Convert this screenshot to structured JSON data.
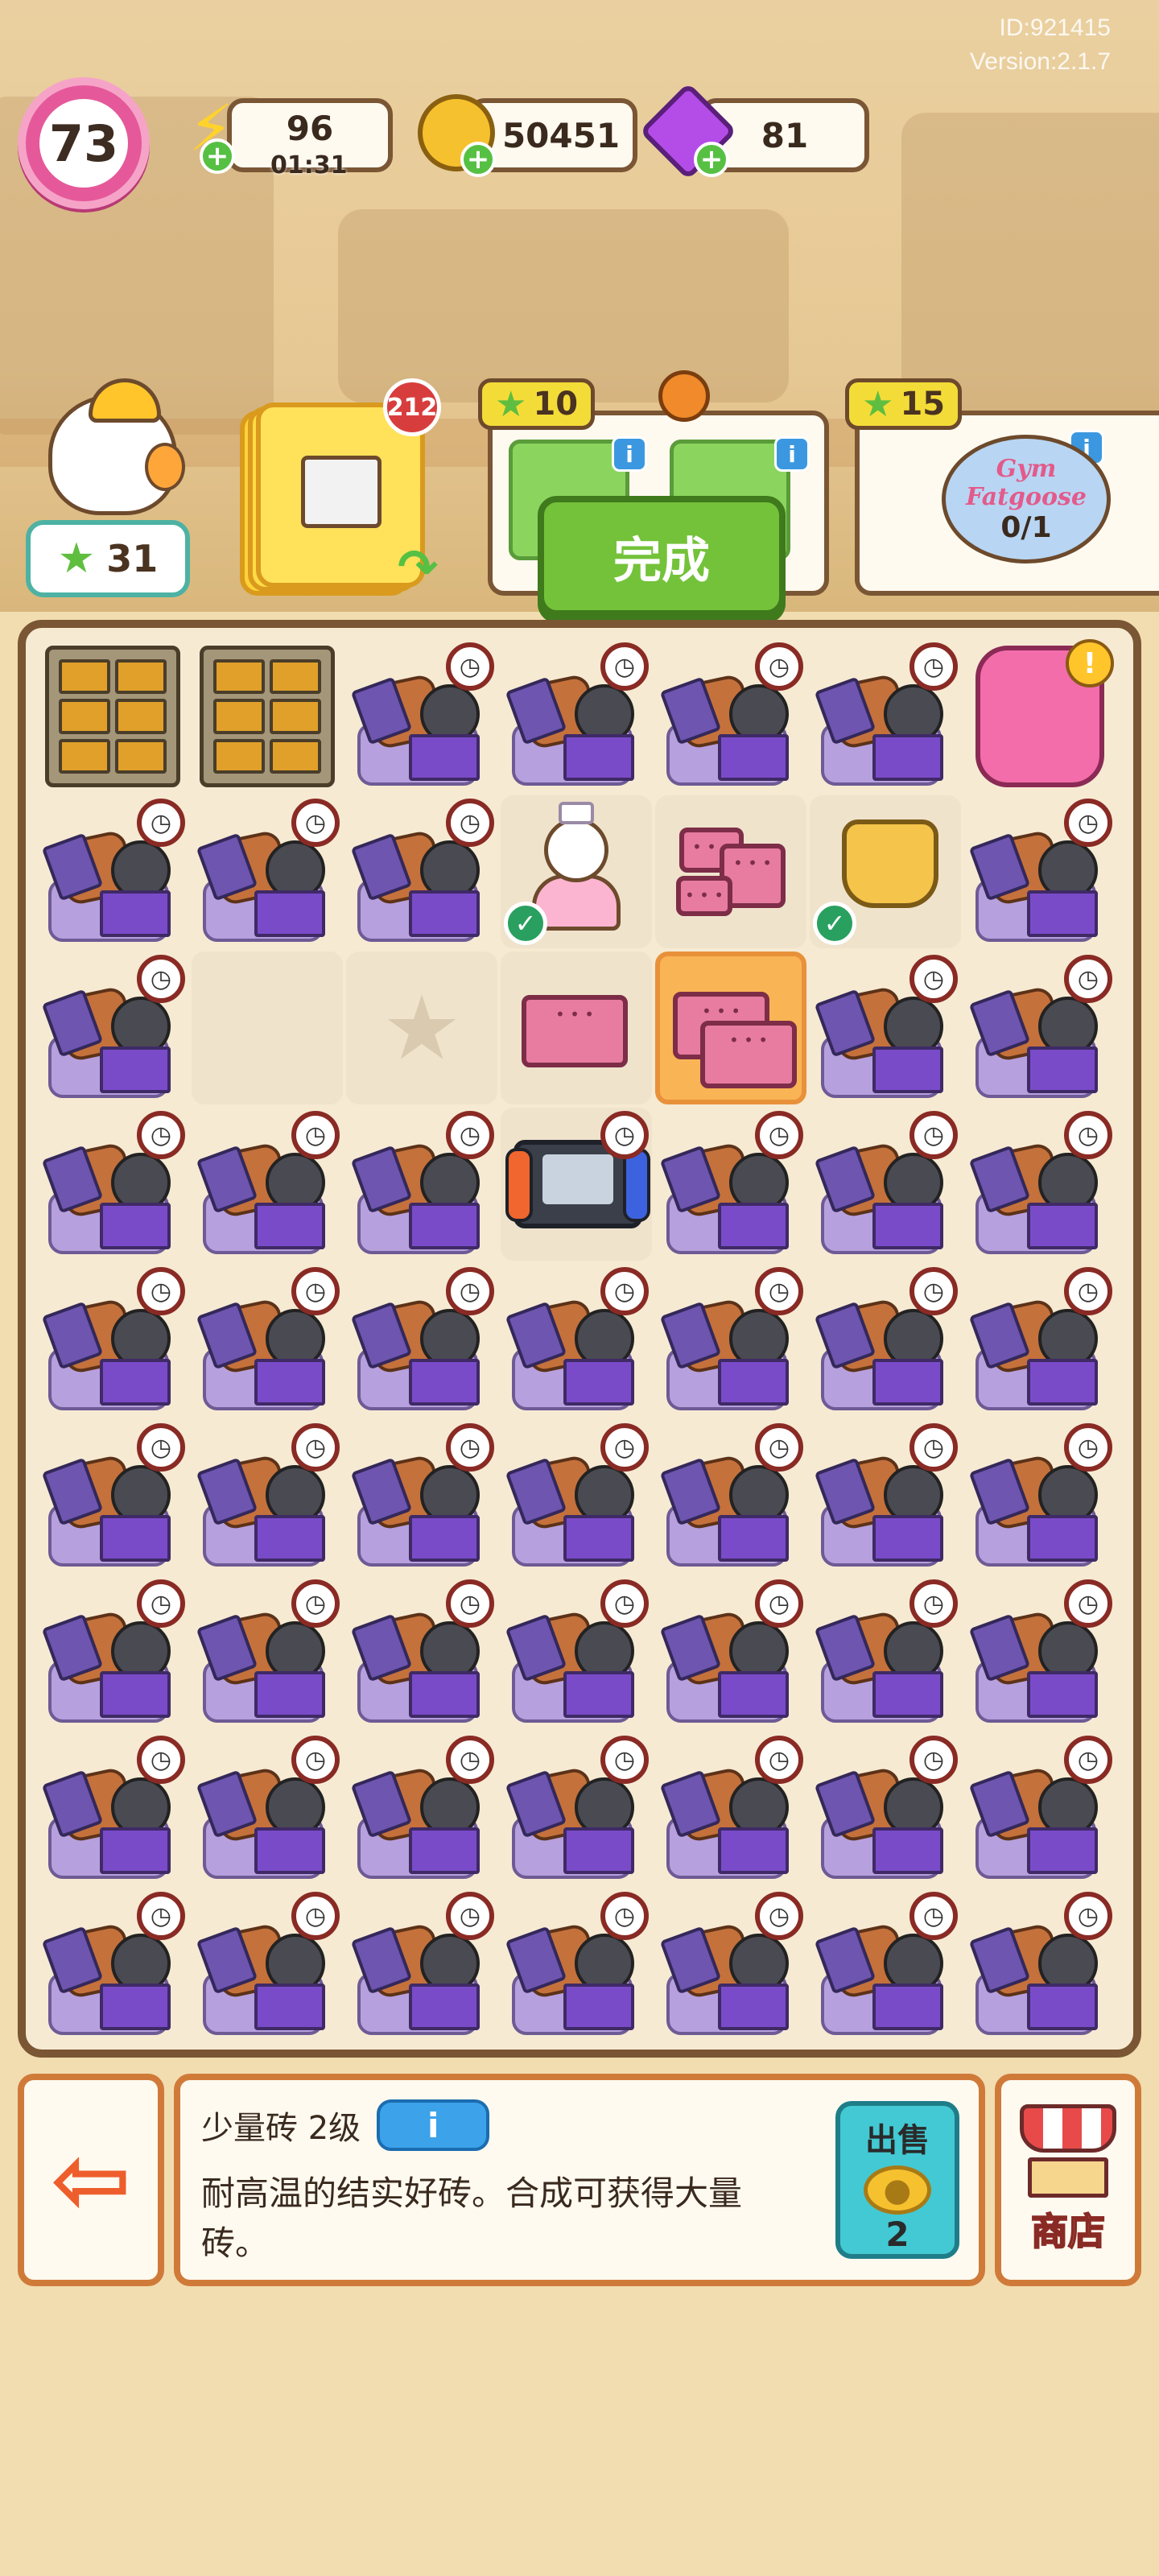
{
  "header": {
    "id_text": "ID:921415",
    "version_text": "Version:2.1.7",
    "level": "73",
    "energy": {
      "value": "96",
      "timer": "01:31",
      "icon": "lightning-icon"
    },
    "coins": {
      "value": "50451",
      "icon": "coin-icon"
    },
    "gems": {
      "value": "81",
      "icon": "gem-icon"
    }
  },
  "quests": {
    "player_stars": "31",
    "card_pack_badge": "212",
    "order1": {
      "reward": "10"
    },
    "order2": {
      "reward": "15",
      "progress": "0/1",
      "logo_line1": "Gym",
      "logo_line2": "Fatgoose"
    },
    "done_button": "完成"
  },
  "board": {
    "rows": 9,
    "cols": 7,
    "cells": [
      "locker",
      "locker",
      "bundle",
      "bundle",
      "bundle",
      "bundle",
      "backpack",
      "bundle",
      "bundle",
      "bundle",
      "princess",
      "bricks2",
      "crown",
      "bundle",
      "bundle",
      "empty",
      "star",
      "brick1",
      "bricks-selected",
      "bundle",
      "bundle",
      "bundle",
      "bundle",
      "bundle",
      "console",
      "bundle",
      "bundle",
      "bundle",
      "bundle",
      "bundle",
      "bundle",
      "bundle",
      "bundle",
      "bundle",
      "bundle",
      "bundle",
      "bundle",
      "bundle",
      "bundle",
      "bundle",
      "bundle",
      "bundle",
      "bundle",
      "bundle",
      "bundle",
      "bundle",
      "bundle",
      "bundle",
      "bundle",
      "bundle",
      "bundle",
      "bundle",
      "bundle",
      "bundle",
      "bundle",
      "bundle",
      "bundle",
      "bundle",
      "bundle",
      "bundle",
      "bundle",
      "bundle",
      "bundle"
    ]
  },
  "info_panel": {
    "item_name": "少量砖 2级",
    "info_label": "i",
    "description": "耐高温的结实好砖。合成可获得大量砖。",
    "sell_label": "出售",
    "sell_price": "2"
  },
  "shop_label": "商店",
  "colors": {
    "done_green": "#74c23a",
    "panel_border": "#d07a3a",
    "level_pink": "#e5599a",
    "highlight_orange": "#f9b455"
  }
}
